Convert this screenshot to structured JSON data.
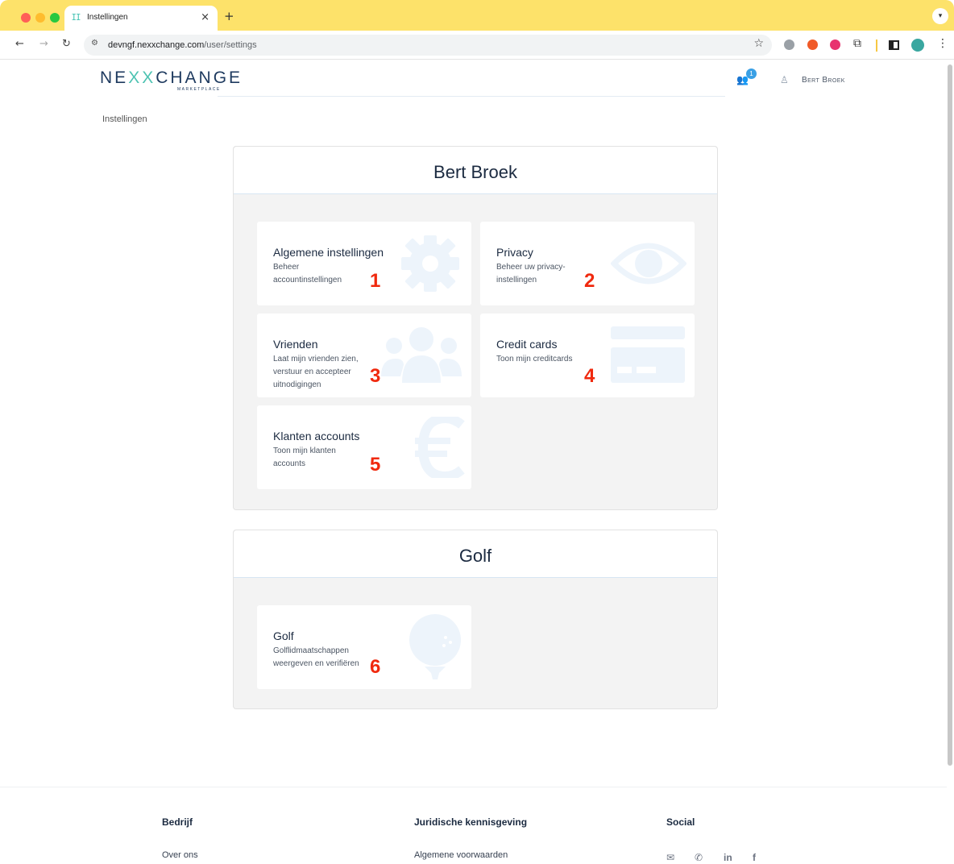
{
  "browser": {
    "tab_title": "Instellingen",
    "url_host": "devngf.nexxchange.com",
    "url_path": "/user/settings"
  },
  "header": {
    "logo_left": "NE",
    "logo_x": "XX",
    "logo_right": "CHANGE",
    "logo_sub": "MARKETPLACE",
    "notification_count": "1",
    "user_name": "Bert Broek"
  },
  "breadcrumb": "Instellingen",
  "panels": [
    {
      "title": "Bert  Broek",
      "cards": [
        {
          "title": "Algemene instellingen",
          "desc": "Beheer accountinstellingen",
          "number": "1",
          "icon": "gear-icon"
        },
        {
          "title": "Privacy",
          "desc": "Beheer uw privacy-instellingen",
          "number": "2",
          "icon": "eye-icon"
        },
        {
          "title": "Vrienden",
          "desc": "Laat mijn vrienden zien, verstuur en accepteer uitnodigingen",
          "number": "3",
          "icon": "users-icon"
        },
        {
          "title": "Credit cards",
          "desc": "Toon mijn creditcards",
          "number": "4",
          "icon": "credit-card-icon"
        },
        {
          "title": "Klanten accounts",
          "desc": "Toon mijn klanten accounts",
          "number": "5",
          "icon": "euro-icon"
        }
      ]
    },
    {
      "title": "Golf",
      "cards": [
        {
          "title": "Golf",
          "desc": "Golflidmaatschappen weergeven en verifiëren",
          "number": "6",
          "icon": "golf-ball-icon"
        }
      ]
    }
  ],
  "footer": {
    "col1_title": "Bedrijf",
    "col1_link": "Over ons",
    "col2_title": "Juridische kennisgeving",
    "col2_link": "Algemene voorwaarden",
    "col3_title": "Social",
    "social_icons": [
      "envelope-icon",
      "phone-icon",
      "linkedin-icon",
      "facebook-icon"
    ],
    "social_glyphs": [
      "✉",
      "✆",
      "in",
      "f"
    ]
  },
  "colors": {
    "accent": "#f0290e",
    "chrome": "#fde26a",
    "icon_tint": "#edf4fb",
    "title": "#1b2a40"
  }
}
